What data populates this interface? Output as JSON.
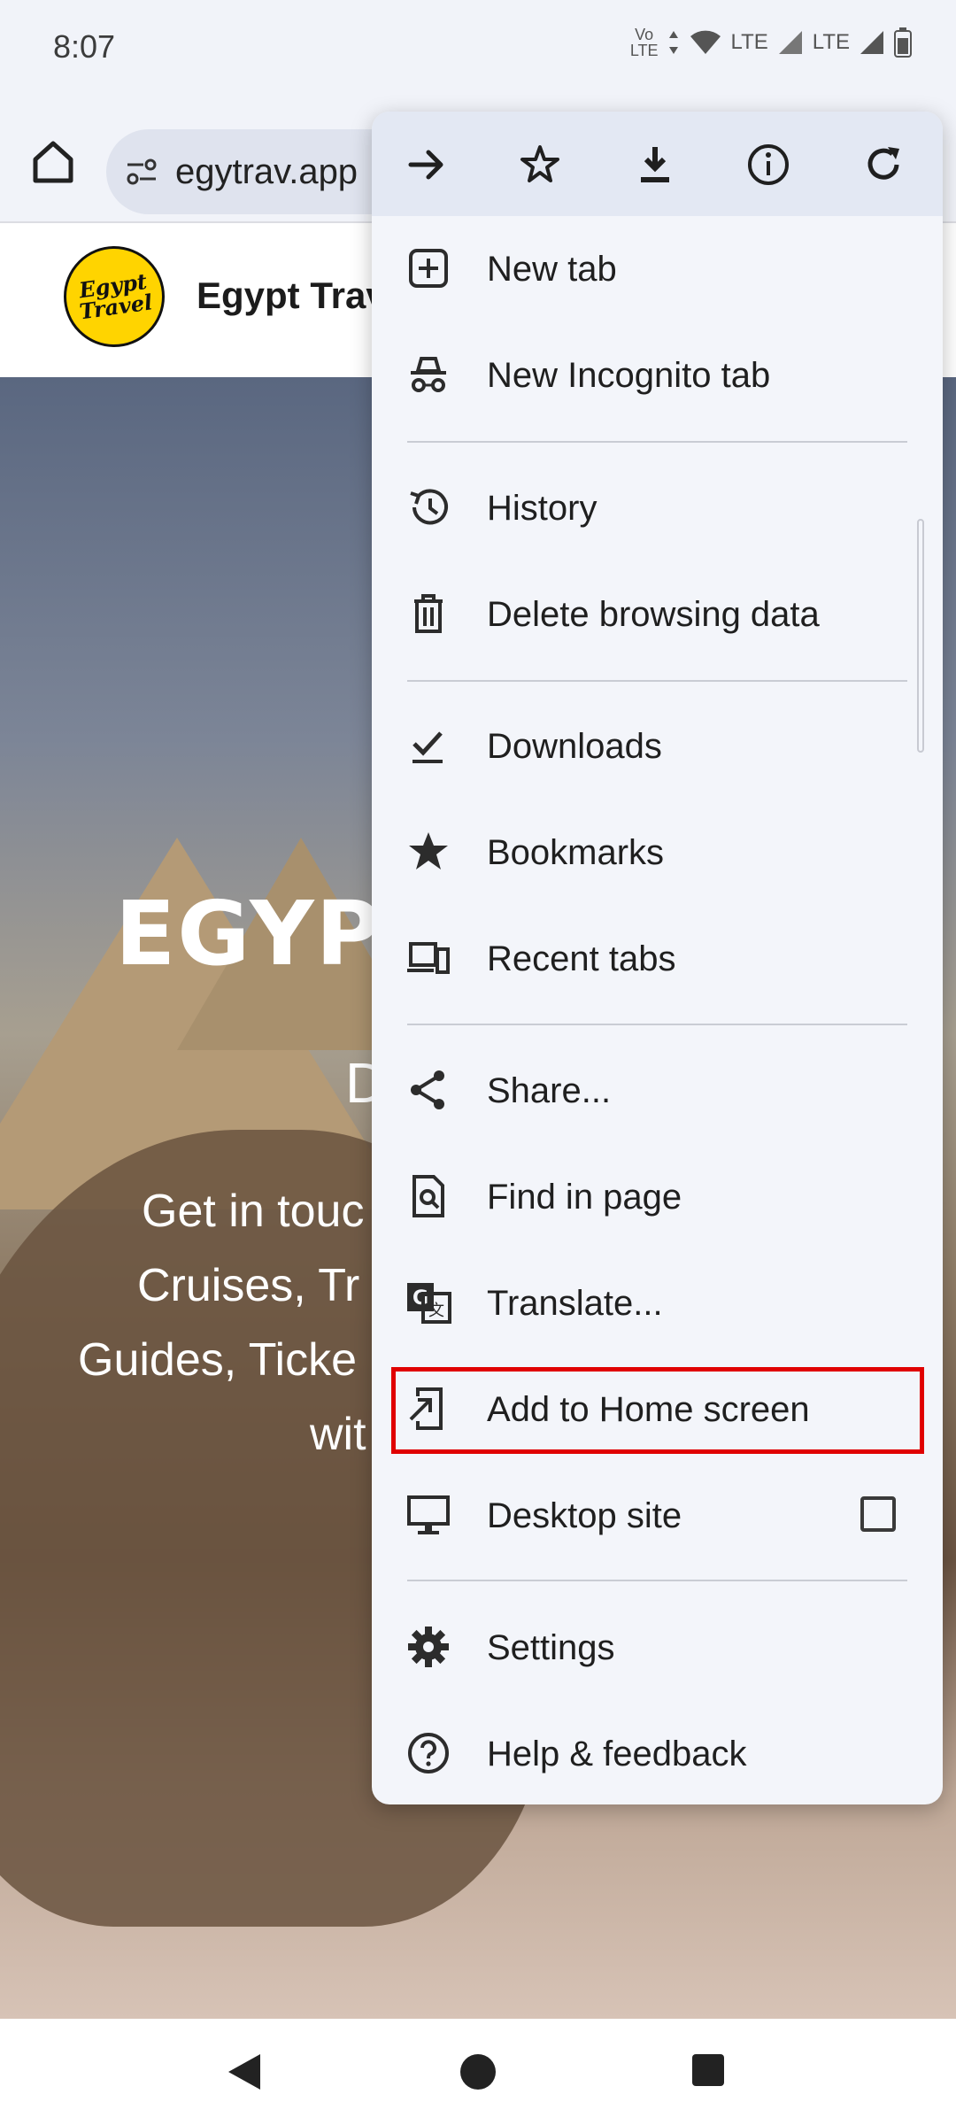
{
  "status_bar": {
    "time": "8:07",
    "icons": [
      "volte-icon",
      "data-arrows-icon",
      "wifi-icon",
      "lte-signal-icon",
      "lte-signal-icon",
      "battery-icon"
    ],
    "lte_1": "LTE",
    "lte_2": "LTE"
  },
  "toolbar": {
    "url": "egytrav.app"
  },
  "site": {
    "logo_line1": "Egypt",
    "logo_line2": "Travel",
    "name": "Egypt Trav"
  },
  "hero": {
    "title": "EGYP",
    "subtitle": "D",
    "lines": [
      "Get in touc",
      "Cruises, Tr",
      "Guides, Ticke",
      "wit"
    ]
  },
  "menu": {
    "top_actions": [
      "forward-icon",
      "bookmark-star-icon",
      "download-icon",
      "page-info-icon",
      "reload-icon"
    ],
    "items": [
      {
        "label": "New tab",
        "icon": "new-tab-icon"
      },
      {
        "label": "New Incognito tab",
        "icon": "incognito-icon"
      },
      {
        "label": "History",
        "icon": "history-icon"
      },
      {
        "label": "Delete browsing data",
        "icon": "trash-icon"
      },
      {
        "label": "Downloads",
        "icon": "downloads-icon"
      },
      {
        "label": "Bookmarks",
        "icon": "bookmarks-icon"
      },
      {
        "label": "Recent tabs",
        "icon": "recent-tabs-icon"
      },
      {
        "label": "Share...",
        "icon": "share-icon"
      },
      {
        "label": "Find in page",
        "icon": "find-in-page-icon"
      },
      {
        "label": "Translate...",
        "icon": "translate-icon"
      },
      {
        "label": "Add to Home screen",
        "icon": "add-to-home-icon"
      },
      {
        "label": "Desktop site",
        "icon": "desktop-icon",
        "checked": false
      },
      {
        "label": "Settings",
        "icon": "settings-icon"
      },
      {
        "label": "Help & feedback",
        "icon": "help-icon"
      }
    ]
  },
  "colors": {
    "highlight": "#e00000",
    "menu_bg": "#f3f5fa",
    "menu_top_bg": "#e3e8f3",
    "logo_yellow": "#ffd400"
  }
}
